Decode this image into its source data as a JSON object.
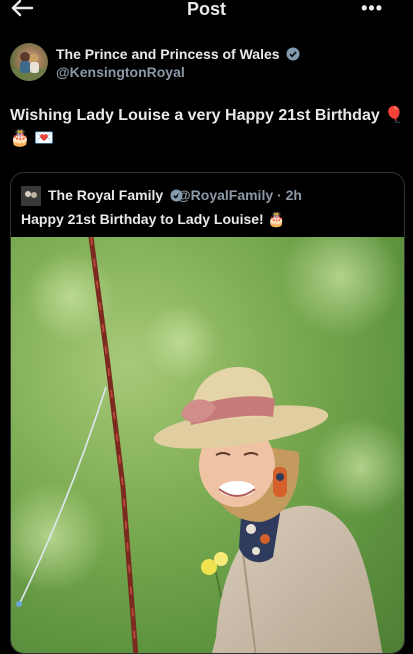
{
  "header": {
    "title": "Post",
    "back_icon": "arrow-left-icon",
    "more_icon": "more-horizontal-icon"
  },
  "post": {
    "author_name": "The Prince and Princess of Wales",
    "author_handle": "@KensingtonRoyal",
    "text": "Wishing Lady Louise a very Happy 21st Birthday",
    "emojis": [
      "🎈",
      "🎂",
      "💌"
    ]
  },
  "quote": {
    "author_name": "The Royal Family",
    "author_handle": "@RoyalFamily",
    "time": "2h",
    "text": "Happy 21st Birthday to Lady Louise!",
    "emoji": "🎂"
  },
  "colors": {
    "background": "#000000",
    "text": "#e7e9ea",
    "muted": "#8b98a5",
    "verified": "#829aab",
    "border": "#2f3336"
  }
}
